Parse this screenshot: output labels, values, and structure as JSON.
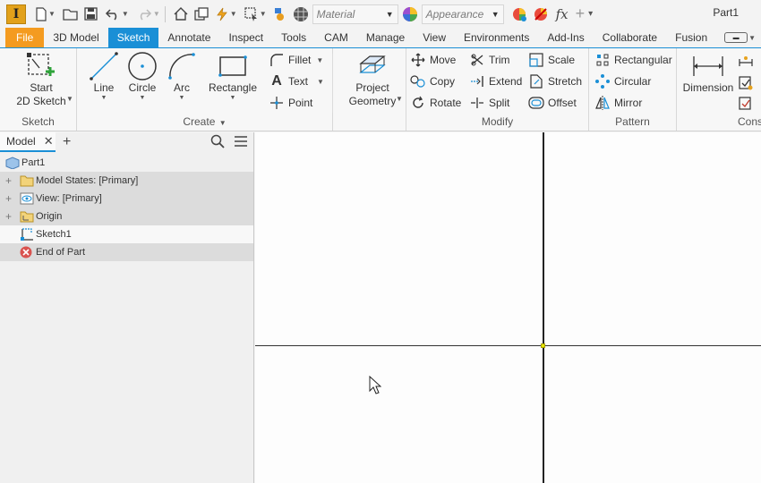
{
  "app": {
    "logo_letter": "I",
    "document_title": "Part1"
  },
  "quick_access": {
    "material_placeholder": "Material",
    "appearance_placeholder": "Appearance",
    "fx_label": "fx"
  },
  "tabs": [
    {
      "label": "File"
    },
    {
      "label": "3D Model"
    },
    {
      "label": "Sketch"
    },
    {
      "label": "Annotate"
    },
    {
      "label": "Inspect"
    },
    {
      "label": "Tools"
    },
    {
      "label": "CAM"
    },
    {
      "label": "Manage"
    },
    {
      "label": "View"
    },
    {
      "label": "Environments"
    },
    {
      "label": "Add-Ins"
    },
    {
      "label": "Collaborate"
    },
    {
      "label": "Fusion"
    }
  ],
  "active_tab": "Sketch",
  "ribbon": {
    "sketch_panel": {
      "title": "Sketch",
      "start_sketch_line1": "Start",
      "start_sketch_line2": "2D Sketch"
    },
    "create_panel": {
      "title": "Create",
      "line": "Line",
      "circle": "Circle",
      "arc": "Arc",
      "rectangle": "Rectangle",
      "fillet": "Fillet",
      "text": "Text",
      "point": "Point",
      "project_geometry_line1": "Project",
      "project_geometry_line2": "Geometry"
    },
    "modify_panel": {
      "title": "Modify",
      "move": "Move",
      "copy": "Copy",
      "rotate": "Rotate",
      "trim": "Trim",
      "extend": "Extend",
      "split": "Split",
      "scale": "Scale",
      "stretch": "Stretch",
      "offset": "Offset"
    },
    "pattern_panel": {
      "title": "Pattern",
      "rectangular": "Rectangular",
      "circular": "Circular",
      "mirror": "Mirror"
    },
    "constrain_panel": {
      "title": "Cons",
      "dimension": "Dimension"
    }
  },
  "browser": {
    "tab_label": "Model",
    "tree": [
      {
        "label": "Part1",
        "icon": "part-icon"
      },
      {
        "label": "Model States: [Primary]",
        "icon": "folder-icon"
      },
      {
        "label": "View: [Primary]",
        "icon": "view-icon"
      },
      {
        "label": "Origin",
        "icon": "origin-folder-icon"
      },
      {
        "label": "Sketch1",
        "icon": "sketch-icon"
      },
      {
        "label": "End of Part",
        "icon": "end-of-part-icon"
      }
    ]
  },
  "colors": {
    "accent": "#1a8fd6",
    "file_tab": "#f49b20",
    "end_of_part": "#d9534f",
    "axis_line": "#222222",
    "origin_point": "#e6e600"
  }
}
